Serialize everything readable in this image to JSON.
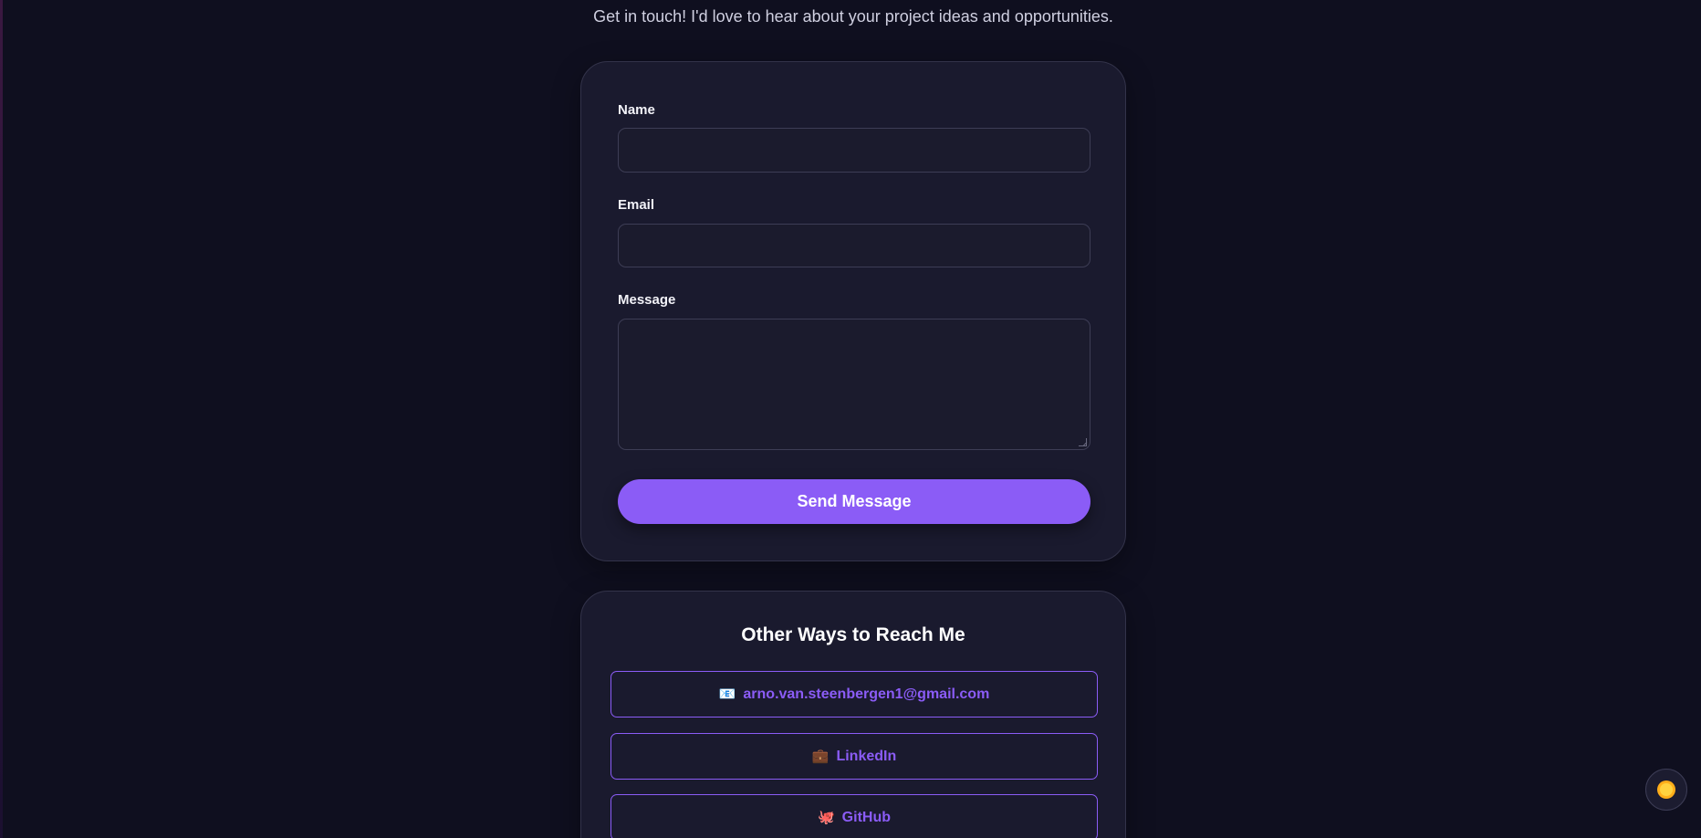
{
  "intro": {
    "text": "Get in touch! I'd love to hear about your project ideas and opportunities."
  },
  "form": {
    "name_label": "Name",
    "name_value": "",
    "email_label": "Email",
    "email_value": "",
    "message_label": "Message",
    "message_value": "",
    "submit_label": "Send Message"
  },
  "reach": {
    "title": "Other Ways to Reach Me",
    "links": [
      {
        "icon": "envelope-icon",
        "glyph": "📧",
        "label": "arno.van.steenbergen1@gmail.com"
      },
      {
        "icon": "briefcase-icon",
        "glyph": "💼",
        "label": "LinkedIn"
      },
      {
        "icon": "octopus-icon",
        "glyph": "🐙",
        "label": "GitHub"
      }
    ]
  },
  "theme_toggle": {
    "icon": "sun-icon"
  },
  "colors": {
    "background": "#0f0f1f",
    "card": "#1a1a2e",
    "accent": "#8b5cf6"
  }
}
